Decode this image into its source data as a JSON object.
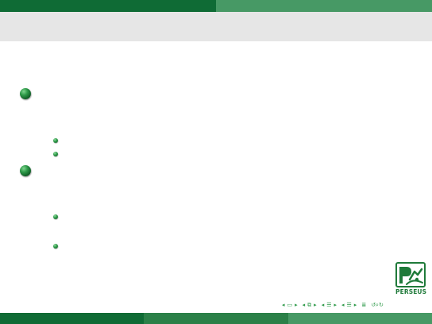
{
  "frame": {
    "title": ""
  },
  "colors": {
    "top_left": "#0f6b35",
    "top_right": "#479965",
    "title_bg": "#e6e6e6",
    "bottom_1": "#0f6b35",
    "bottom_2": "#2b8048",
    "bottom_3": "#479965",
    "bullet": "#1a7a35"
  },
  "items": [
    {
      "text": "",
      "subitems": [
        {
          "text": ""
        },
        {
          "text": ""
        }
      ]
    },
    {
      "text": "",
      "subitems": [
        {
          "text": ""
        },
        {
          "text": ""
        }
      ]
    }
  ],
  "logo": {
    "label": "PERSEUS",
    "icon": "perseus-logo-icon"
  },
  "navigation": {
    "icons": [
      "nav-prev-icon",
      "nav-frame-icon",
      "nav-next-icon",
      "nav-prev-icon",
      "nav-section-icon",
      "nav-next-icon",
      "nav-prev-icon",
      "nav-subsection-icon",
      "nav-next-icon",
      "nav-prev-icon",
      "nav-subsubsection-icon",
      "nav-next-icon",
      "nav-outline-icon",
      "nav-search-icon"
    ]
  }
}
